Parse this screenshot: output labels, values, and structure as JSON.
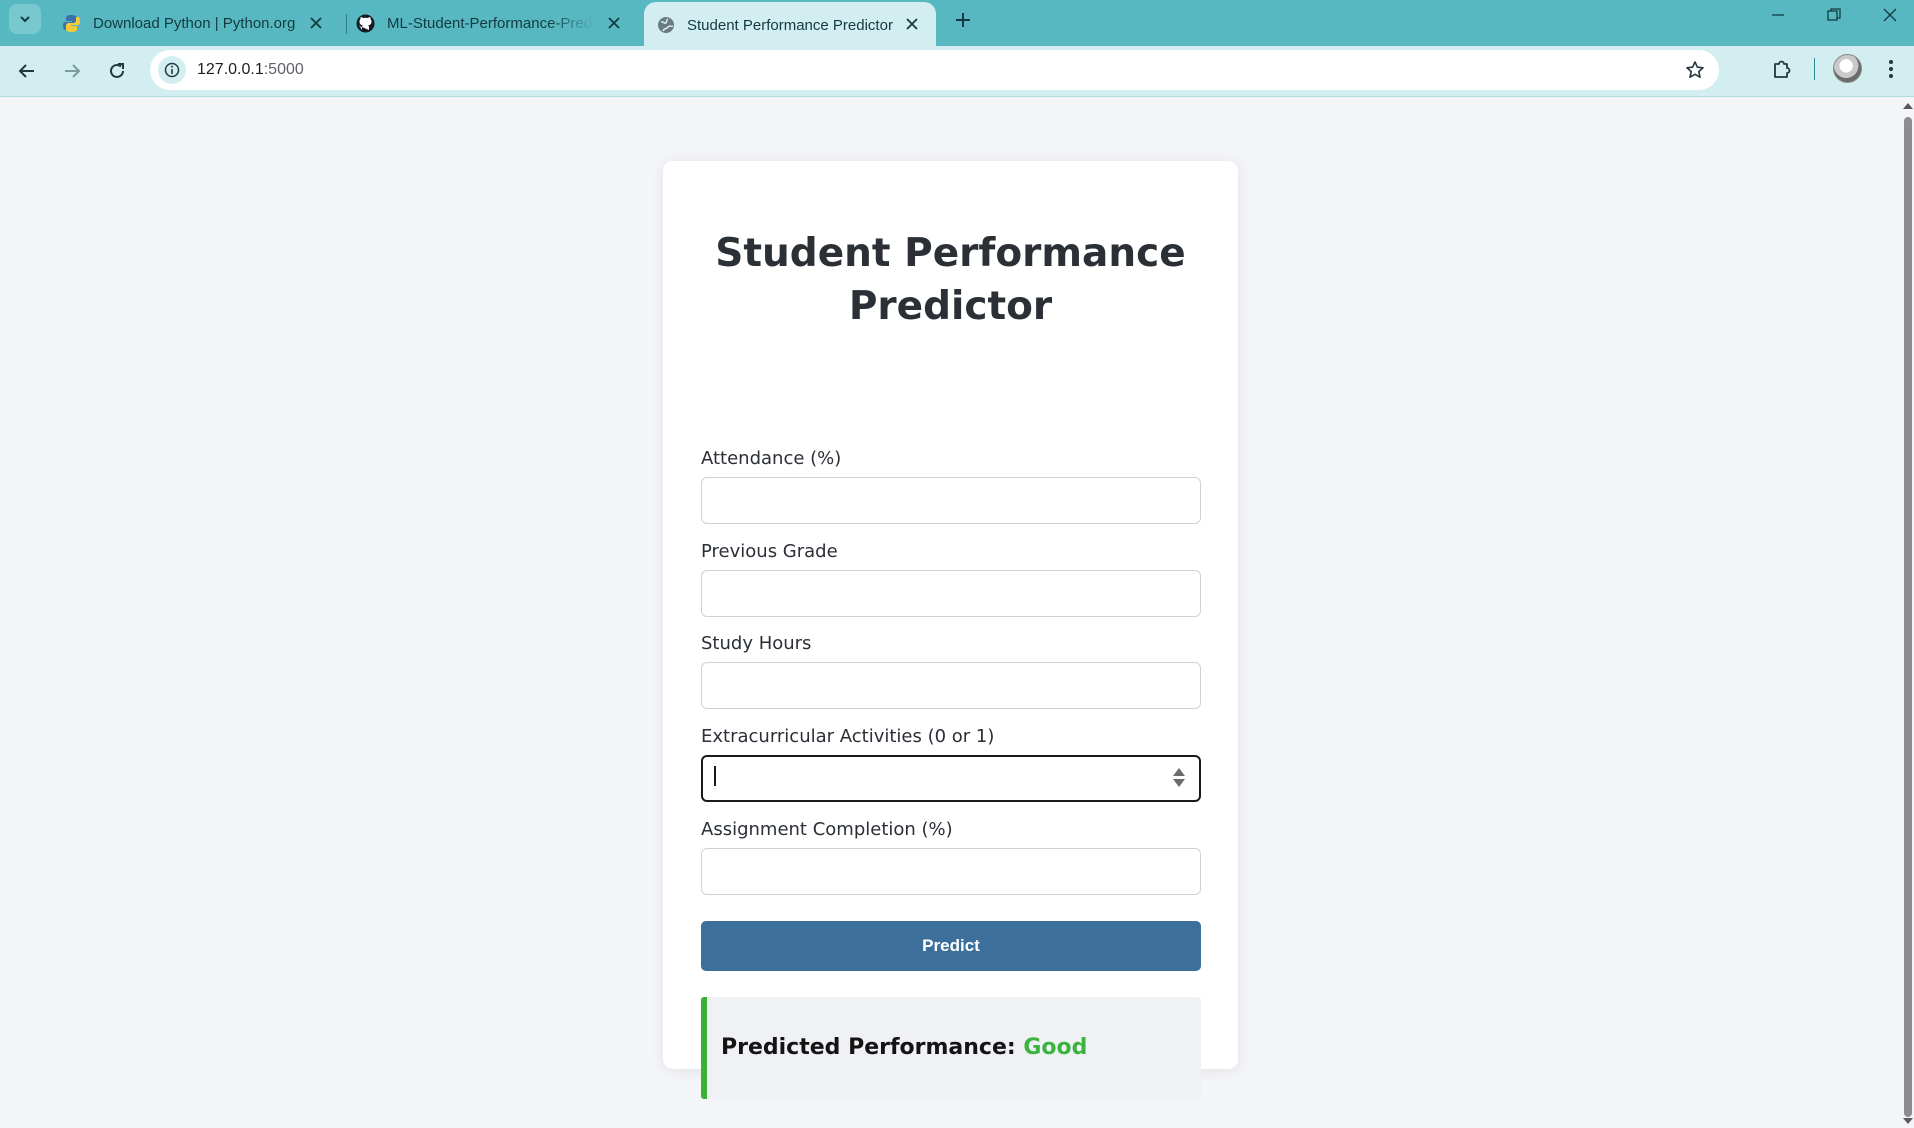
{
  "browser": {
    "tabs": [
      {
        "title": "Download Python | Python.org",
        "favicon": "python-icon"
      },
      {
        "title": "ML-Student-Performance-Predictor",
        "favicon": "github-icon"
      },
      {
        "title": "Student Performance Predictor",
        "favicon": "globe-icon",
        "active": true
      }
    ],
    "url_host": "127.0.0.1",
    "url_port": ":5000"
  },
  "page": {
    "title": "Student Performance Predictor",
    "fields": [
      {
        "label": "Attendance (%)",
        "value": ""
      },
      {
        "label": "Previous Grade",
        "value": ""
      },
      {
        "label": "Study Hours",
        "value": ""
      },
      {
        "label": "Extracurricular Activities (0 or 1)",
        "value": ""
      },
      {
        "label": "Assignment Completion (%)",
        "value": ""
      }
    ],
    "predict_label": "Predict",
    "result": {
      "prefix": "Predicted Performance:",
      "value": "Good"
    }
  },
  "colors": {
    "tabstrip": "#57b8c2",
    "toolbar": "#d3eef1",
    "button": "#3d6f9b",
    "result_accent": "#36b239",
    "result_value": "#3bb43f"
  }
}
